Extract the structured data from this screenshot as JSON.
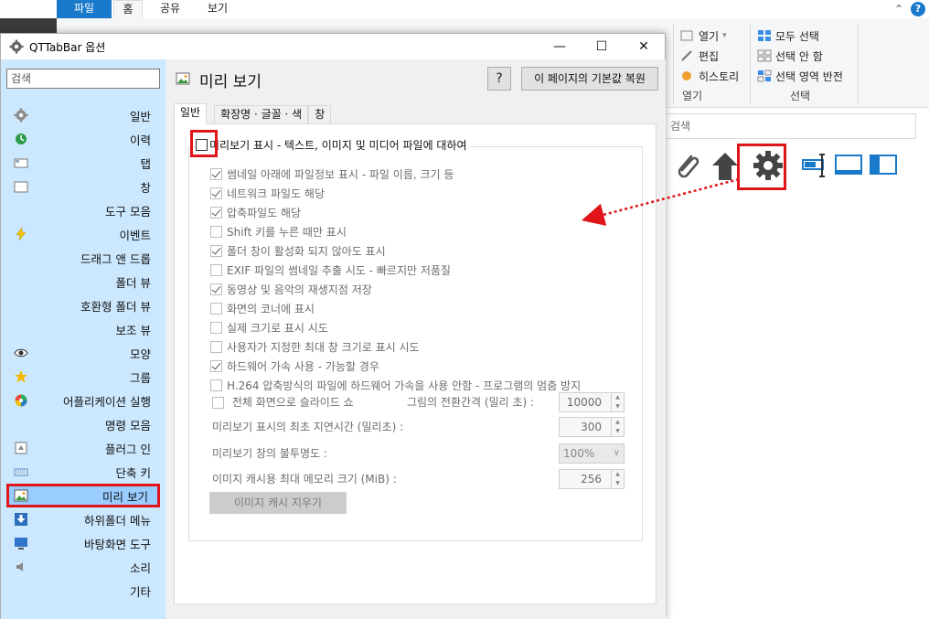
{
  "explorer": {
    "ribbon_tabs": [
      "파일",
      "홈",
      "공유",
      "보기"
    ],
    "open_group": {
      "items": [
        "열기",
        "편집",
        "히스토리"
      ],
      "label": "열기"
    },
    "select_group": {
      "items": [
        "모두 선택",
        "선택 안 함",
        "선택 영역 반전"
      ],
      "label": "선택"
    },
    "search_placeholder": "검색",
    "toolbar_icons": [
      "paperclip-icon",
      "up-arrow-icon",
      "gear-icon",
      "text-cursor-icon",
      "pane-bottom-icon",
      "pane-left-icon"
    ]
  },
  "dialog": {
    "title": "QTTabBar 옵션",
    "sidebar": {
      "search_placeholder": "검색",
      "items": [
        {
          "label": "일반",
          "icon": "gear-icon"
        },
        {
          "label": "이력",
          "icon": "history-icon"
        },
        {
          "label": "탭",
          "icon": "tab-icon"
        },
        {
          "label": "창",
          "icon": "window-icon"
        },
        {
          "label": "도구 모음",
          "icon": ""
        },
        {
          "label": "이벤트",
          "icon": "lightning-icon"
        },
        {
          "label": "드래그 앤 드롭",
          "icon": ""
        },
        {
          "label": "폴더 뷰",
          "icon": ""
        },
        {
          "label": "호환형 폴더 뷰",
          "icon": ""
        },
        {
          "label": "보조 뷰",
          "icon": ""
        },
        {
          "label": "모양",
          "icon": "eye-icon"
        },
        {
          "label": "그룹",
          "icon": "star-icon"
        },
        {
          "label": "어플리케이션 실행",
          "icon": "color-wheel-icon"
        },
        {
          "label": "명령 모음",
          "icon": ""
        },
        {
          "label": "플러그 인",
          "icon": "plugin-icon"
        },
        {
          "label": "단축 키",
          "icon": "keyboard-icon"
        },
        {
          "label": "미리 보기",
          "icon": "picture-icon"
        },
        {
          "label": "하위폴더 메뉴",
          "icon": "down-arrow-icon"
        },
        {
          "label": "바탕화면 도구",
          "icon": "desktop-icon"
        },
        {
          "label": "소리",
          "icon": "speaker-icon"
        },
        {
          "label": "기타",
          "icon": ""
        }
      ]
    },
    "page_title": "미리 보기",
    "help_label": "?",
    "restore_label": "이 페이지의 기본값 복원",
    "tabs": [
      "일반",
      "확장명 · 글꼴 · 색",
      "창"
    ],
    "master_checkbox": {
      "label": "미리보기 표시 - 텍스트, 이미지 및 미디어 파일에 대하여",
      "checked": false
    },
    "options": [
      {
        "label": "썸네일 아래에 파일정보 표시 - 파일 이름, 크기 등",
        "checked": true
      },
      {
        "label": "네트워크 파일도 해당",
        "checked": true
      },
      {
        "label": "압축파일도 해당",
        "checked": true
      },
      {
        "label": "Shift 키를 누른 때만 표시",
        "checked": false
      },
      {
        "label": "폴더 창이 활성화 되지 않아도 표시",
        "checked": true
      },
      {
        "label": "EXIF 파일의 썸네일 추출 시도 - 빠르지만 저품질",
        "checked": false
      },
      {
        "label": "동영상 및 음악의 재생지점 저장",
        "checked": true
      },
      {
        "label": "화면의 코너에 표시",
        "checked": false
      },
      {
        "label": "실제 크기로 표시 시도",
        "checked": false
      },
      {
        "label": "사용자가 지정한 최대 창 크기로 표시 시도",
        "checked": false
      },
      {
        "label": "하드웨어 가속 사용 - 가능할 경우",
        "checked": true
      },
      {
        "label": "H.264 압축방식의 파일에 하드웨어 가속을 사용 안함 - 프로그램의 멈춤 방지",
        "checked": false
      }
    ],
    "slideshow": {
      "label": "전체 화면으로 슬라이드 쇼",
      "checked": false,
      "interval_label": "그림의 전환간격 (밀리 초) :",
      "interval_value": "10000"
    },
    "delay": {
      "label": "미리보기 표시의 최초 지연시간 (밀리초) :",
      "value": "300"
    },
    "opacity": {
      "label": "미리보기 창의 불투명도 :",
      "value": "100%"
    },
    "cache": {
      "label": "이미지 캐시용 최대 메모리 크기 (MiB) :",
      "value": "256"
    },
    "clear_cache_label": "이미지 캐시 지우기"
  },
  "colors": {
    "highlight": "#e0151a",
    "sidebar_bg": "#cce8ff",
    "selected_bg": "#99ccff",
    "accent": "#1979ca"
  }
}
